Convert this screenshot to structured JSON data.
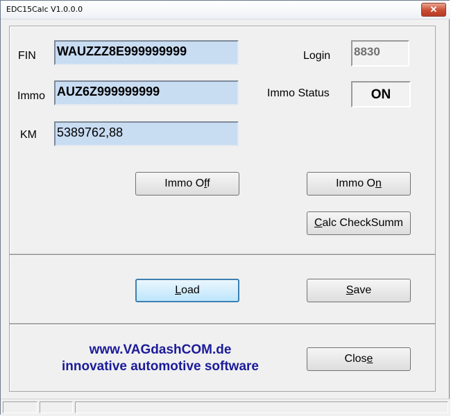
{
  "window": {
    "title": "EDC15Calc V1.0.0.0",
    "close_glyph": "✕"
  },
  "fields": {
    "fin": {
      "label": "FIN",
      "value": "WAUZZZ8E999999999"
    },
    "immo": {
      "label": "Immo",
      "value": "AUZ6Z999999999"
    },
    "km": {
      "label": "KM",
      "value": "5389762,88"
    },
    "login": {
      "label": "Login",
      "value": "8830"
    },
    "immo_status": {
      "label": "Immo Status",
      "value": "ON"
    }
  },
  "buttons": {
    "immo_off": {
      "pre": "Immo O",
      "mnemonic": "f",
      "post": "f"
    },
    "immo_on": {
      "pre": "Immo O",
      "mnemonic": "n",
      "post": ""
    },
    "calc": {
      "pre": "",
      "mnemonic": "C",
      "post": "alc CheckSumm"
    },
    "load": {
      "pre": "",
      "mnemonic": "L",
      "post": "oad"
    },
    "save": {
      "pre": "",
      "mnemonic": "S",
      "post": "ave"
    },
    "close": {
      "pre": "Clos",
      "mnemonic": "e",
      "post": ""
    }
  },
  "branding": {
    "line1": "www.VAGdashCOM.de",
    "line2": "innovative automotive software"
  }
}
